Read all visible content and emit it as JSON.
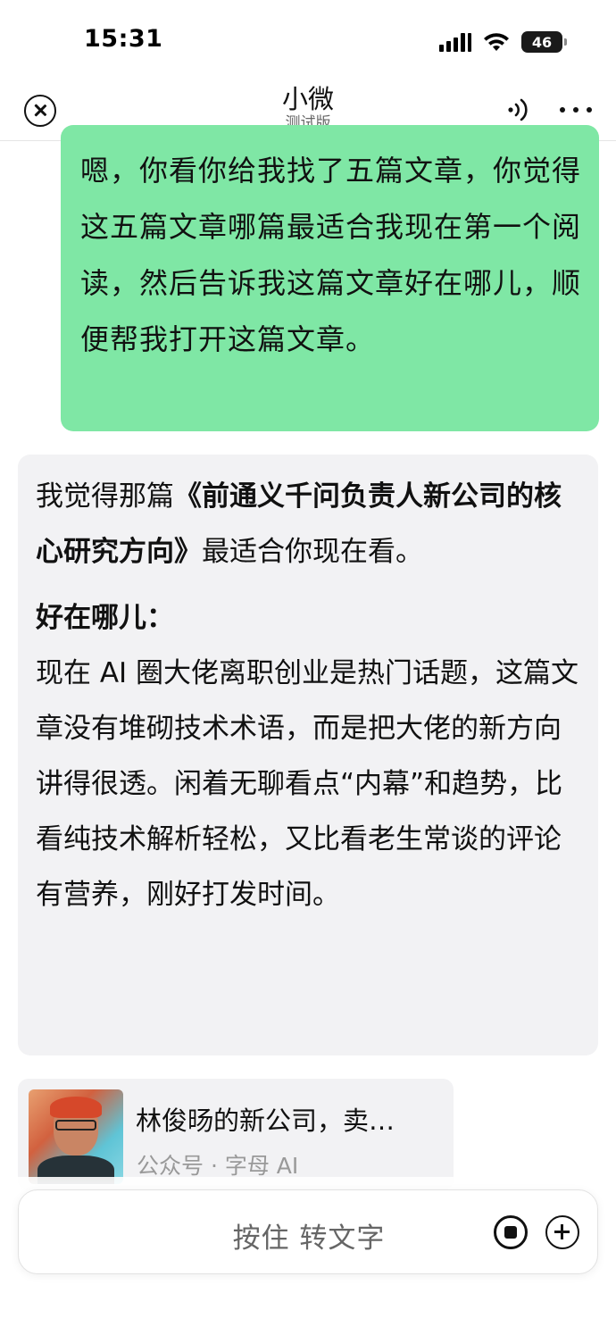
{
  "status_bar": {
    "time": "15:31",
    "battery": "46"
  },
  "header": {
    "title": "小微",
    "subtitle": "测试版"
  },
  "messages": {
    "user": "嗯，你看你给我找了五篇文章，你觉得这五篇文章哪篇最适合我现在第一个阅读，然后告诉我这篇文章好在哪儿，顺便帮我打开这篇文章。",
    "assistant": {
      "intro_prefix": "我觉得那篇",
      "article_ref": "《前通义千问负责人新公司的核心研究方向》",
      "intro_suffix": "最适合你现在看。",
      "section_heading": "好在哪儿：",
      "section_body": "现在 AI 圈大佬离职创业是热门话题，这篇文章没有堆砌技术术语，而是把大佬的新方向讲得很透。闲着无聊看点“内幕”和趋势，比看纯技术解析轻松，又比看老生常谈的评论有营养，刚好打发时间。"
    }
  },
  "article_card": {
    "title": "林俊旸的新公司，卖…",
    "source": "公众号 · 字母 AI"
  },
  "input": {
    "hold_to_talk": "按住 转文字"
  }
}
